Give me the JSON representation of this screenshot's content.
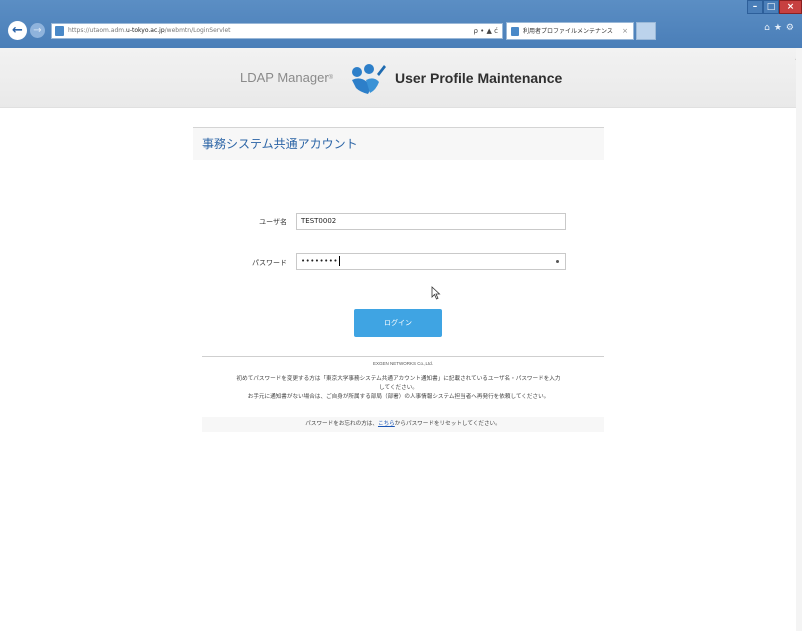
{
  "browser": {
    "url_scheme": "https://",
    "url_host_prefix": "utaom.adm.",
    "url_domain": "u-tokyo.ac.jp",
    "url_path": "/webmtn/LoginServlet",
    "address_tools": "ρ • ▲ ć",
    "tab_title": "利用者プロファイルメンテナンス",
    "tab_close": "×",
    "win_min": "–",
    "win_max": "□",
    "win_close": "×",
    "chrome_icons": "⌂★⚙"
  },
  "header": {
    "ldap_manager": "LDAP Manager",
    "ldap_mark": "®",
    "product": "User Profile Maintenance"
  },
  "section": {
    "title": "事務システム共通アカウント"
  },
  "form": {
    "username_label": "ユーザ名",
    "username_value": "TEST0002",
    "password_label": "パスワード",
    "password_value": "••••••••",
    "login_label": "ログイン"
  },
  "footer": {
    "company": "EXGEN NETWORKS Co.,Ltd.",
    "notice_line1": "初めてパスワードを変更する方は「東京大学事務システム共通アカウント通知書」に記載されているユーザ名・パスワードを入力",
    "notice_line2": "してください。",
    "notice_line3": "お手元に通知書がない場合は、ご自身が所属する部局（部署）の人事情報システム担当者へ再発行を依頼してください。",
    "reset_prefix": "パスワードをお忘れの方は、",
    "reset_link": "こちら",
    "reset_suffix": "からパスワードをリセットしてください。"
  },
  "colors": {
    "accent": "#3fa4e3",
    "title_blue": "#2b64a6",
    "logo_blue": "#2d7fc9",
    "chrome_blue": "#4a7eb8"
  }
}
